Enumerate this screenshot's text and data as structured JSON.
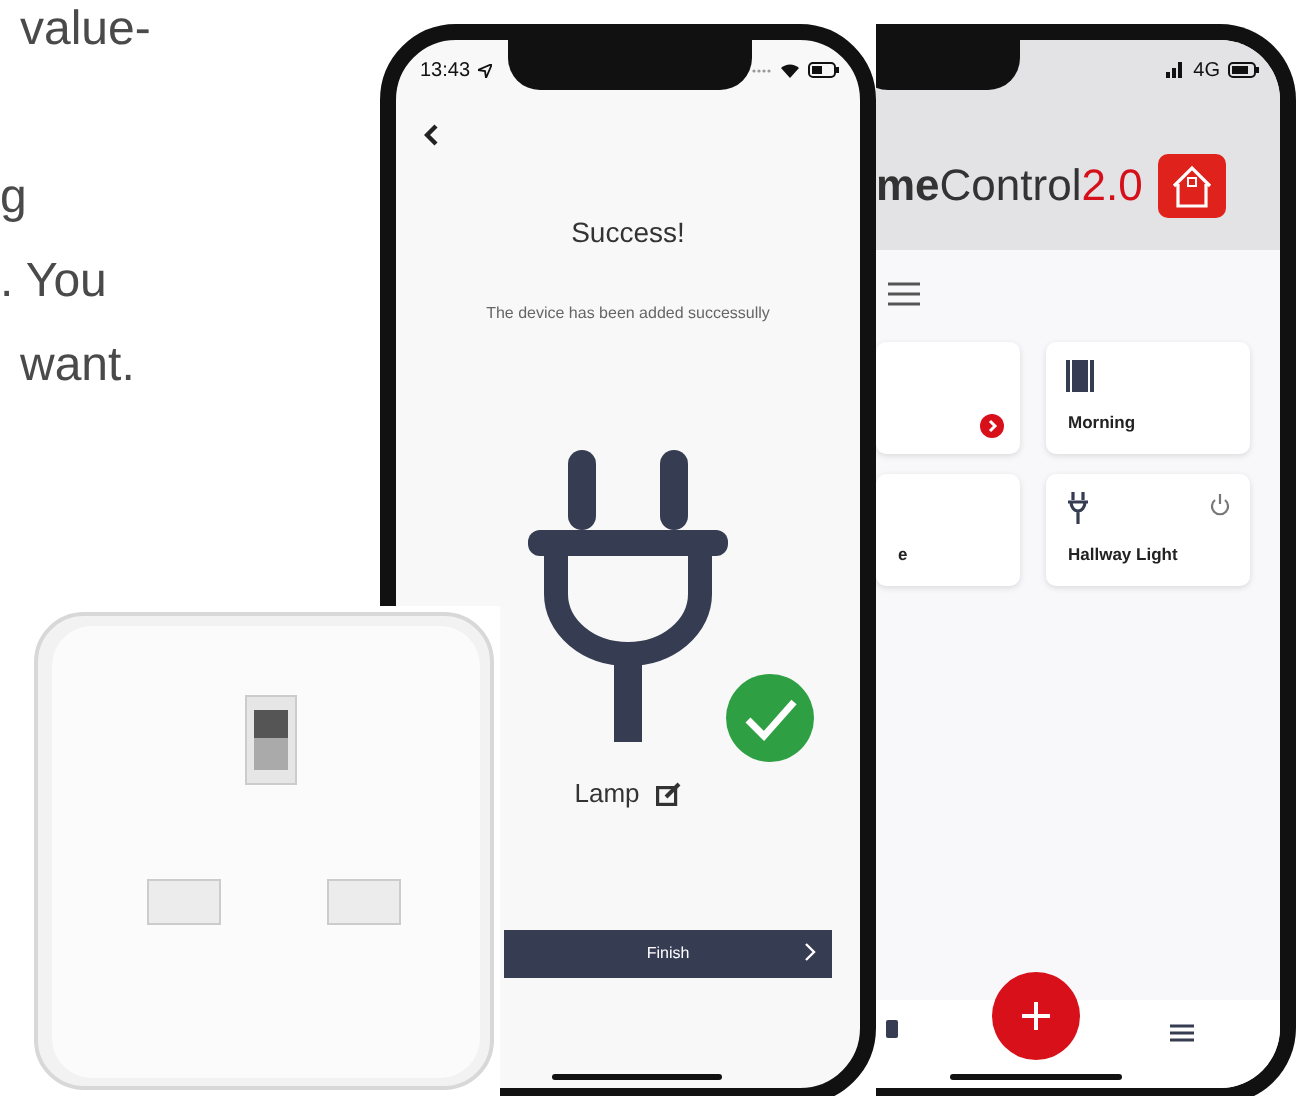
{
  "intro_lines": [
    "value-",
    "g",
    ". You",
    "want."
  ],
  "front_phone": {
    "status_time": "13:43",
    "title": "Success!",
    "message": "The device has been added successully",
    "device_name": "Lamp",
    "finish_button": "Finish"
  },
  "back_phone": {
    "network": "4G",
    "logo": {
      "lead": "me",
      "name": "Control",
      "version": "2.0"
    },
    "tiles": [
      {
        "kind": "group"
      },
      {
        "kind": "scene",
        "name": "Morning"
      },
      {
        "kind": "label",
        "name": "e"
      },
      {
        "kind": "plug",
        "name": "Hallway Light"
      }
    ]
  }
}
